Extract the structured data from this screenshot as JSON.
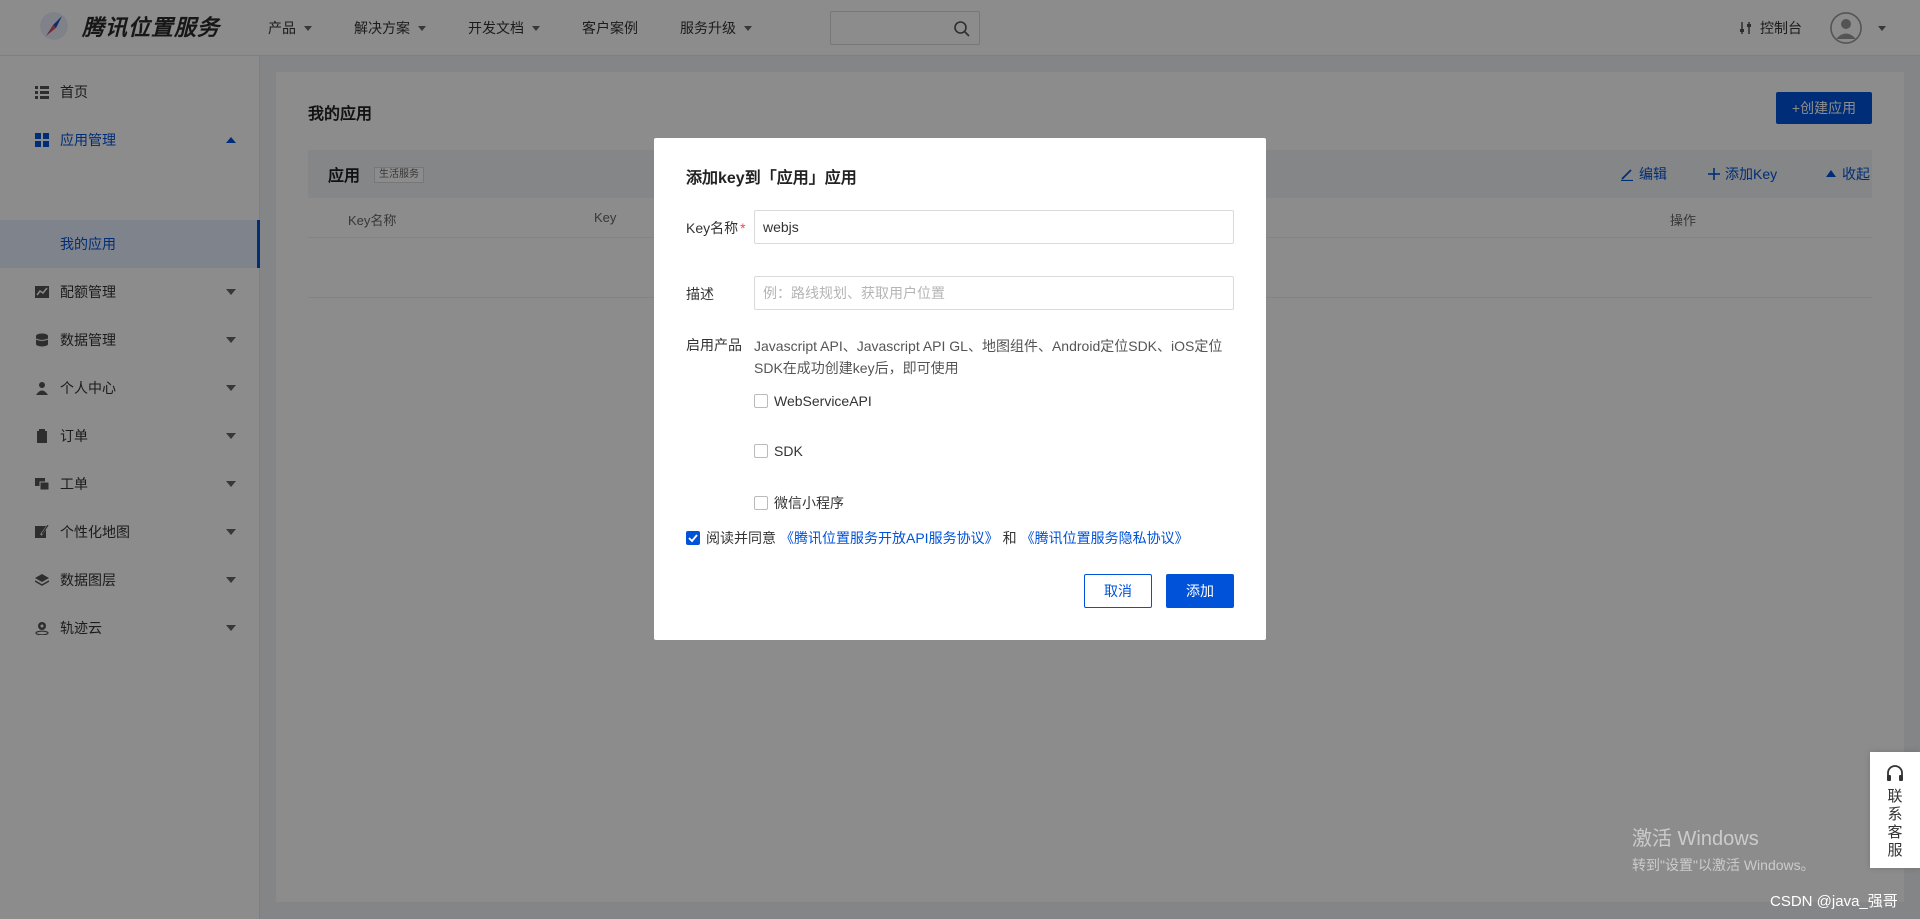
{
  "header": {
    "logo_text": "腾讯位置服务",
    "nav": [
      "产品",
      "解决方案",
      "开发文档",
      "客户案例",
      "服务升级"
    ],
    "nav_has_caret": [
      true,
      true,
      true,
      false,
      true
    ],
    "search_placeholder": "",
    "console_label": "控制台"
  },
  "sidebar": {
    "items": [
      {
        "label": "首页",
        "icon": "home-list-icon"
      },
      {
        "label": "应用管理",
        "icon": "grid-icon"
      },
      {
        "label": "配额管理",
        "icon": "chart-icon"
      },
      {
        "label": "数据管理",
        "icon": "database-icon"
      },
      {
        "label": "个人中心",
        "icon": "user-icon"
      },
      {
        "label": "订单",
        "icon": "clipboard-icon"
      },
      {
        "label": "工单",
        "icon": "ticket-icon"
      },
      {
        "label": "个性化地图",
        "icon": "map-edit-icon"
      },
      {
        "label": "数据图层",
        "icon": "layers-icon"
      },
      {
        "label": "轨迹云",
        "icon": "track-icon"
      }
    ],
    "sub_item": "我的应用"
  },
  "main": {
    "title": "我的应用",
    "create_button": "+创建应用",
    "app_name": "应用",
    "app_tag": "生活服务",
    "actions": {
      "edit": "编辑",
      "add_key": "添加Key",
      "collapse": "收起"
    },
    "table_headers": {
      "key_name": "Key名称",
      "key": "Key",
      "ops": "操作"
    }
  },
  "modal": {
    "title": "添加key到「应用」应用",
    "key_name_label": "Key名称",
    "key_name_value": "webjs",
    "desc_label": "描述",
    "desc_placeholder": "例：路线规划、获取用户位置",
    "products_label": "启用产品",
    "products_desc": "Javascript API、Javascript API GL、地图组件、Android定位SDK、iOS定位SDK在成功创建key后，即可使用",
    "options": [
      {
        "label": "WebServiceAPI",
        "checked": false
      },
      {
        "label": "SDK",
        "checked": false
      },
      {
        "label": "微信小程序",
        "checked": false
      }
    ],
    "agree_checked": true,
    "agree_prefix": "阅读并同意",
    "agree_link1": "《腾讯位置服务开放API服务协议》",
    "agree_and": "和",
    "agree_link2": "《腾讯位置服务隐私协议》",
    "cancel_label": "取消",
    "add_label": "添加"
  },
  "float_service": {
    "label": "联系客服"
  },
  "watermark": {
    "line1": "激活 Windows",
    "line2": "转到\"设置\"以激活 Windows。"
  },
  "csdn_credit": "CSDN @java_强哥",
  "colors": {
    "primary": "#0052d9",
    "overlay": "rgba(0,0,0,0.45)",
    "required": "#e34d59"
  }
}
